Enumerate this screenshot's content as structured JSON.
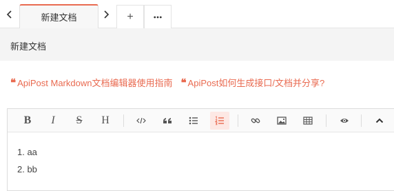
{
  "tabs": {
    "prev_icon": "chevron-left-icon",
    "next_icon": "chevron-right-icon",
    "active_label": "新建文档",
    "add_label": "+",
    "more_icon": "more-icon",
    "accent_color": "#e96a50"
  },
  "document": {
    "title": "新建文档"
  },
  "links": [
    {
      "label": "ApiPost Markdown文档编辑器使用指南"
    },
    {
      "label": "ApiPost如何生成接口/文档并分享?"
    }
  ],
  "toolbar": {
    "bold": "B",
    "italic": "I",
    "strike": "S",
    "heading": "H",
    "buttons": [
      "bold",
      "italic",
      "strikethrough",
      "heading",
      "code",
      "quote",
      "unordered-list",
      "ordered-list",
      "link",
      "image",
      "table",
      "preview",
      "collapse"
    ],
    "active": "ordered-list"
  },
  "content": {
    "lines": [
      "1. aa",
      "2. bb"
    ]
  }
}
